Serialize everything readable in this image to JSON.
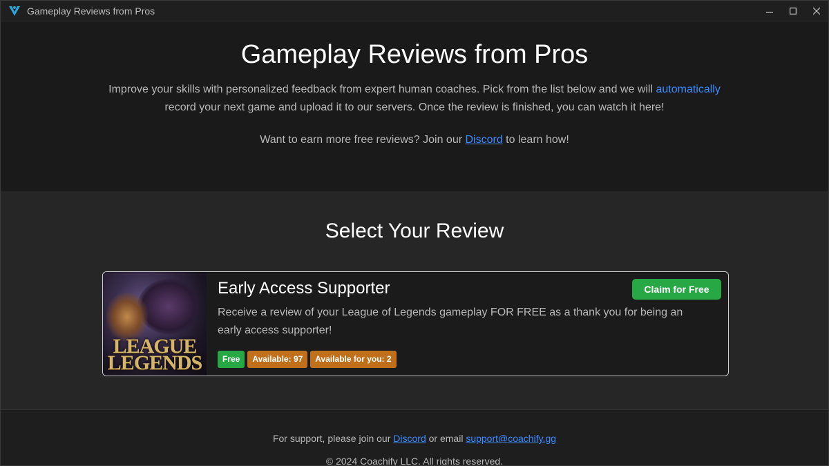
{
  "window": {
    "title": "Gameplay Reviews from Pros",
    "controls": {
      "minimize": "—",
      "maximize": "☐",
      "close": "✕"
    }
  },
  "hero": {
    "heading": "Gameplay Reviews from Pros",
    "desc_part1": "Improve your skills with personalized feedback from expert human coaches. Pick from the list below and we will ",
    "desc_link": "automatically",
    "desc_part2": " record your next game and upload it to our servers. Once the review is finished, you can watch it here!",
    "earn_part1": "Want to earn more free reviews? Join our ",
    "earn_link": "Discord",
    "earn_part2": " to learn how!"
  },
  "select": {
    "heading": "Select Your Review",
    "cards": [
      {
        "title": "Early Access Supporter",
        "description": "Receive a review of your League of Legends gameplay FOR FREE as a thank you for being an early access supporter!",
        "thumb_logo_line1": "LEAGUE",
        "thumb_logo_line2": "LEGENDS",
        "button_label": "Claim for Free",
        "badges": [
          "Free",
          "Available: 97",
          "Available for you: 2"
        ]
      }
    ]
  },
  "footer": {
    "support_part1": "For support, please join our ",
    "support_discord": "Discord",
    "support_part2": " or email ",
    "support_email": "support@coachify.gg",
    "copyright": "© 2024 Coachify LLC. All rights reserved."
  },
  "colors": {
    "accent_link": "#3d8bff",
    "button_green": "#28a745",
    "badge_orange": "#c0701a",
    "app_icon": "#2fa3d8"
  }
}
